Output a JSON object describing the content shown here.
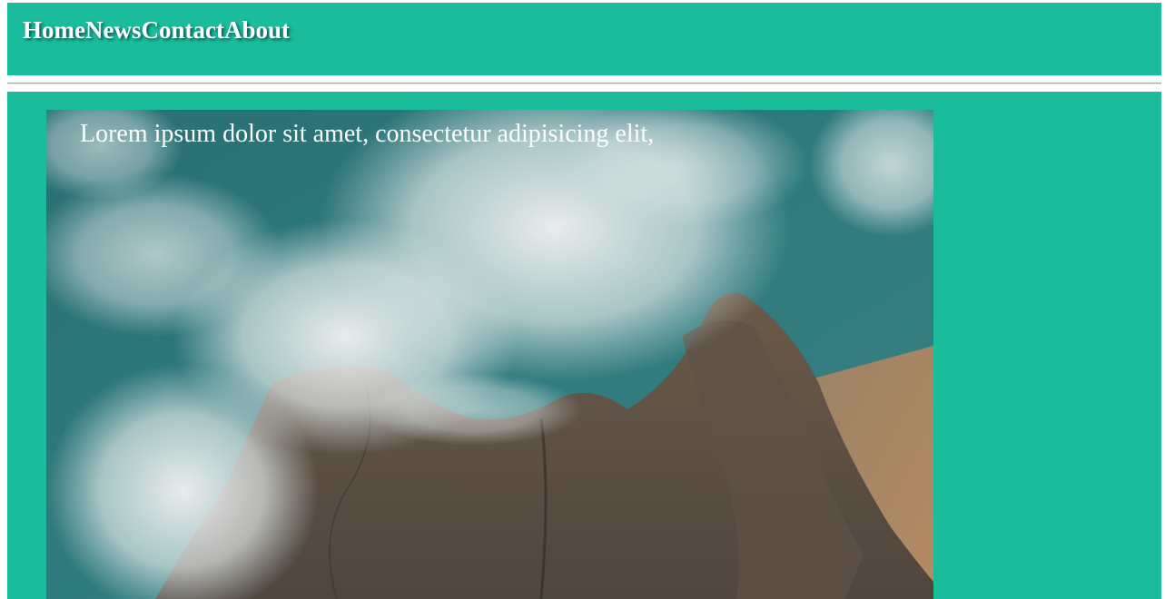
{
  "nav": {
    "items": [
      {
        "label": "Home"
      },
      {
        "label": "News"
      },
      {
        "label": "Contact"
      },
      {
        "label": "About"
      }
    ]
  },
  "hero": {
    "text": "Lorem ipsum dolor sit amet, consectetur adipisicing elit,",
    "image_subject": "aerial view of ocean waves crashing on rocky shore"
  },
  "colors": {
    "accent": "#1abc9c",
    "text_on_accent": "#ffffff"
  }
}
